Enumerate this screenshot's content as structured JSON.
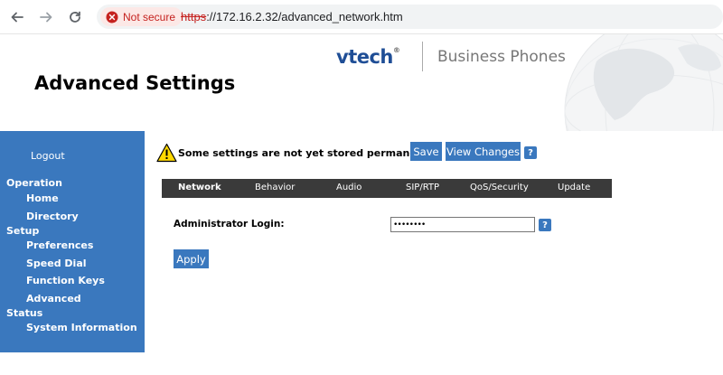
{
  "browser": {
    "security_label": "Not secure",
    "url_scheme": "https",
    "url_rest": "://172.16.2.32/advanced_network.htm"
  },
  "header": {
    "title": "Advanced Settings",
    "brand": "vtech",
    "brand_mark": "®",
    "tagline": "Business Phones"
  },
  "sidebar": {
    "logout": "Logout",
    "sections": [
      {
        "heading": "Operation",
        "items": [
          "Home",
          "Directory"
        ]
      },
      {
        "heading": "Setup",
        "items": [
          "Preferences",
          "Speed Dial",
          "Function Keys",
          "Advanced"
        ]
      },
      {
        "heading": "Status",
        "items": [
          "System Information"
        ]
      }
    ]
  },
  "notice": {
    "text": "Some settings are not yet stored permanently.",
    "save_label": "Save",
    "view_changes_label": "View Changes",
    "help": "?"
  },
  "tabs": [
    {
      "label": "Network",
      "active": true
    },
    {
      "label": "Behavior",
      "active": false
    },
    {
      "label": "Audio",
      "active": false
    },
    {
      "label": "SIP/RTP",
      "active": false
    },
    {
      "label": "QoS/Security",
      "active": false
    },
    {
      "label": "Update",
      "active": false
    }
  ],
  "form": {
    "admin_login_label": "Administrator Login:",
    "admin_login_value": "••••••••",
    "help": "?",
    "apply_label": "Apply"
  },
  "colors": {
    "accent": "#3a78be",
    "tabbar": "#3a3a3a",
    "brand": "#1f4e96",
    "not_secure": "#c5221f"
  }
}
